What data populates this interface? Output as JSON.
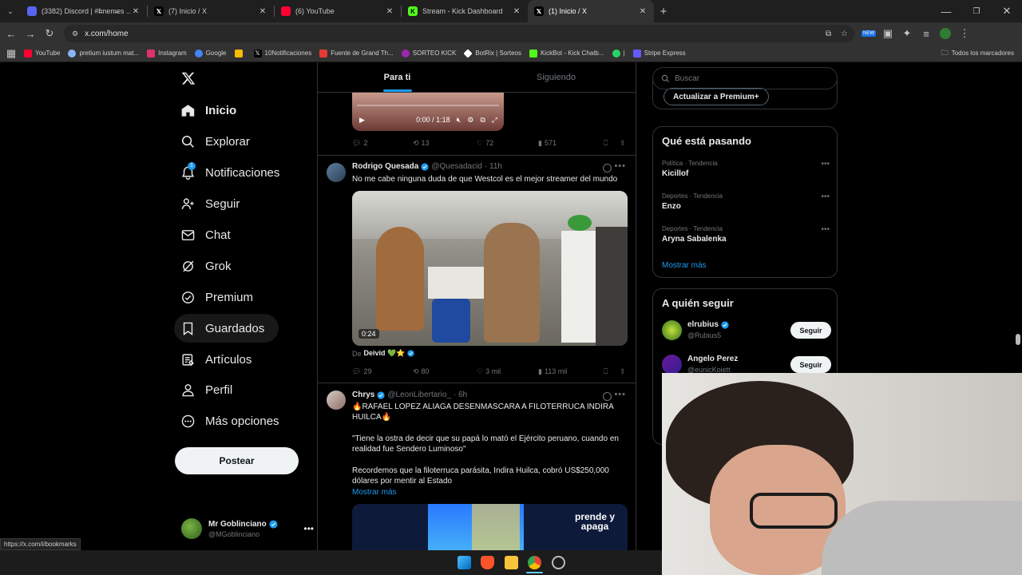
{
  "browser": {
    "tabs": [
      {
        "title": "(3382) Discord | #f̶mem̶es ...",
        "favicon_color": "#5865f2"
      },
      {
        "title": "(7) Inicio / X",
        "favicon_color": "#000000"
      },
      {
        "title": "(6) YouTube",
        "favicon_color": "#ff0033"
      },
      {
        "title": "Stream - Kick Dashboard",
        "favicon_color": "#53fc18"
      },
      {
        "title": "(1) Inicio / X",
        "favicon_color": "#000000"
      }
    ],
    "active_tab_index": 4,
    "url": "x.com/home",
    "bookmarks": [
      {
        "label": "YouTube",
        "color": "#ff0033"
      },
      {
        "label": "pretium iustum mat...",
        "color": "#8ab4f8"
      },
      {
        "label": "Instagram",
        "color": "#e1306c"
      },
      {
        "label": "Google",
        "color": "#4285f4"
      },
      {
        "label": "",
        "color": "#fbbc04"
      },
      {
        "label": "10Notificaciones",
        "color": "#000000"
      },
      {
        "label": "Fuente de Grand Th...",
        "color": "#e53935"
      },
      {
        "label": "SORTEO KICK",
        "color": "#9c27b0"
      },
      {
        "label": "BotRix | Sorteos",
        "color": "#ffffff"
      },
      {
        "label": "KickBot - Kick Chatb...",
        "color": "#53fc18"
      },
      {
        "label": "|",
        "color": "#25d366"
      },
      {
        "label": "Stripe Express",
        "color": "#635bff"
      }
    ],
    "all_bookmarks": "Todos los marcadores",
    "status_url": "https://x.com/i/bookmarks"
  },
  "nav": {
    "items": [
      {
        "label": "Inicio",
        "icon": "home-icon"
      },
      {
        "label": "Explorar",
        "icon": "search-icon"
      },
      {
        "label": "Notificaciones",
        "icon": "bell-icon",
        "badge": "1"
      },
      {
        "label": "Seguir",
        "icon": "person-add-icon"
      },
      {
        "label": "Chat",
        "icon": "envelope-icon"
      },
      {
        "label": "Grok",
        "icon": "grok-icon"
      },
      {
        "label": "Premium",
        "icon": "verified-badge-icon"
      },
      {
        "label": "Guardados",
        "icon": "bookmark-icon"
      },
      {
        "label": "Artículos",
        "icon": "article-icon"
      },
      {
        "label": "Perfil",
        "icon": "person-icon"
      },
      {
        "label": "Más opciones",
        "icon": "more-circle-icon"
      }
    ],
    "post_label": "Postear",
    "account": {
      "name": "Mr Goblinciano",
      "handle": "@MGoblinciano"
    }
  },
  "timeline": {
    "tabs": [
      "Para ti",
      "Siguiendo"
    ],
    "tweet0": {
      "video_time": "0:00 / 1:18",
      "replies": "2",
      "reposts": "13",
      "likes": "72",
      "views": "571"
    },
    "tweet1": {
      "name": "Rodrigo Quesada",
      "handle": "@Quesadacid",
      "time": "· 11h",
      "text": "No me cabe ninguna duda de que Westcol es el mejor streamer del mundo",
      "video_duration": "0:24",
      "from_prefix": "De",
      "from_name": "Deivid 💚⭐",
      "replies": "29",
      "reposts": "80",
      "likes": "3 mil",
      "views": "113 mil"
    },
    "tweet2": {
      "name": "Chrys",
      "handle": "@LeonLibertario_",
      "time": "· 6h",
      "line1": "🔥RAFAEL LOPEZ ALIAGA DESENMASCARA A FILOTERRUCA INDIRA HUILCA🔥",
      "line2": "\"Tiene la ostra de decir que su papá lo mató el Ejército peruano, cuando en realidad fue Sendero Luminoso\"",
      "line3": "Recordemos que la filoterruca parásita, Indira Huilca, cobró US$250,000 dólares por mentir al Estado",
      "show_more": "Mostrar más",
      "media_logo_1": "prende y",
      "media_logo_2": "apaga"
    }
  },
  "right": {
    "search_placeholder": "Buscar",
    "premium_button": "Actualizar a Premium+",
    "trends_title": "Qué está pasando",
    "trends": [
      {
        "category": "Política · Tendencia",
        "name": "Kicillof"
      },
      {
        "category": "Deportes · Tendencia",
        "name": "Enzo"
      },
      {
        "category": "Deportes · Tendencia",
        "name": "Aryna Sabalenka"
      }
    ],
    "show_more": "Mostrar más",
    "who_title": "A quién seguir",
    "who": [
      {
        "name": "elrubius",
        "handle": "@Rubius5",
        "button": "Seguir"
      },
      {
        "name": "Angelo Perez",
        "handle": "@eunicKoiett",
        "button": "Seguir"
      }
    ]
  },
  "colors": {
    "accent": "#1d9bf0",
    "border": "#2f3336",
    "muted": "#71767b"
  }
}
